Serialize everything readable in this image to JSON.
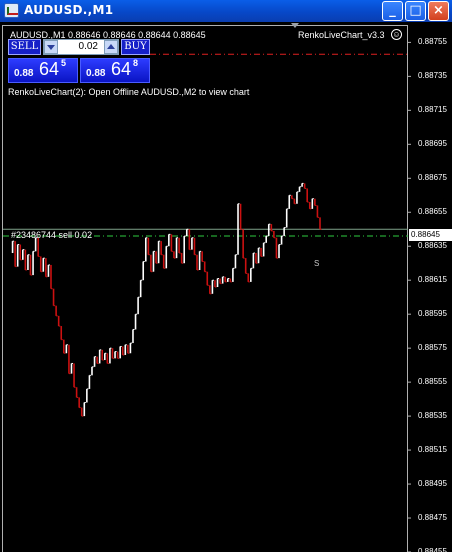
{
  "window": {
    "title": "AUDUSD.,M1",
    "controls": {
      "minimize": "_",
      "maximize": "□",
      "close": "×"
    }
  },
  "chart_header": {
    "symbol_line": "AUDUSD.,M1  0.88646 0.88646 0.88644 0.88645"
  },
  "indicator": {
    "name": "RenkoLiveChart_v3.3",
    "icon": "smiley-icon"
  },
  "trade_panel": {
    "sell_label": "SELL",
    "buy_label": "BUY",
    "lot_value": "0.02",
    "sell_price": {
      "small": "0.88",
      "big": "64",
      "sup": "5"
    },
    "buy_price": {
      "small": "0.88",
      "big": "64",
      "sup": "8"
    }
  },
  "offline_message": "RenkoLiveChart(2): Open Offline AUDUSD.,M2 to view chart",
  "order_label": "#23486744 sell 0.02",
  "s_marker": "S",
  "current_price": "0.88645",
  "colors": {
    "background": "#000000",
    "bull_bar": "#ffffff",
    "bear_bar": "#cc1111",
    "bid_line": "#7fa38a",
    "order_line": "#2ecc40",
    "ask_line": "#e02020",
    "accent": "#1620c8"
  },
  "chart_data": {
    "type": "line",
    "title": "",
    "xlabel": "",
    "ylabel": "",
    "ylim": [
      0.88455,
      0.88767
    ],
    "yticks": [
      "0.88755",
      "0.88735",
      "0.88715",
      "0.88695",
      "0.88675",
      "0.88655",
      "0.88635",
      "0.88615",
      "0.88595",
      "0.88575",
      "0.88555",
      "0.88535",
      "0.88515",
      "0.88495",
      "0.88475",
      "0.88455"
    ],
    "lines": [
      {
        "name": "order",
        "value": 0.88641,
        "style": "dash-dot"
      },
      {
        "name": "ask",
        "value": 0.88748,
        "style": "dash-dot"
      },
      {
        "name": "bid",
        "value": 0.88645,
        "style": "solid"
      }
    ],
    "series": [
      {
        "values": [
          0.88631,
          0.88638,
          0.88623,
          0.88636,
          0.88627,
          0.88633,
          0.88621,
          0.8863,
          0.88618,
          0.88632,
          0.8864,
          0.88629,
          0.8862,
          0.88628,
          0.88617,
          0.88624,
          0.8861,
          0.886,
          0.88594,
          0.88588,
          0.8858,
          0.88572,
          0.88577,
          0.8856,
          0.88566,
          0.88552,
          0.88546,
          0.8854,
          0.88535,
          0.88543,
          0.88551,
          0.88559,
          0.88564,
          0.8857,
          0.88566,
          0.88574,
          0.88568,
          0.88572,
          0.88566,
          0.88575,
          0.88569,
          0.88573,
          0.88569,
          0.88576,
          0.88571,
          0.88577,
          0.88572,
          0.88578,
          0.88586,
          0.88595,
          0.88605,
          0.88615,
          0.88626,
          0.8864,
          0.8863,
          0.8862,
          0.88632,
          0.88625,
          0.88638,
          0.8863,
          0.88622,
          0.88635,
          0.88642,
          0.88632,
          0.88628,
          0.8864,
          0.88631,
          0.88625,
          0.88641,
          0.88645,
          0.88633,
          0.8864,
          0.8863,
          0.88621,
          0.88632,
          0.88626,
          0.8862,
          0.88612,
          0.88607,
          0.88615,
          0.88611,
          0.88616,
          0.88613,
          0.88617,
          0.88614,
          0.88616,
          0.88614,
          0.88622,
          0.8863,
          0.8866,
          0.88645,
          0.88628,
          0.88619,
          0.88614,
          0.88622,
          0.88631,
          0.88625,
          0.88634,
          0.88629,
          0.88637,
          0.88641,
          0.88648,
          0.88644,
          0.8864,
          0.88628,
          0.88636,
          0.88641,
          0.88646,
          0.88657,
          0.88665,
          0.88663,
          0.8866,
          0.88667,
          0.8867,
          0.88672,
          0.88669,
          0.88661,
          0.88657,
          0.88663,
          0.88659,
          0.88652,
          0.88645
        ]
      }
    ]
  }
}
